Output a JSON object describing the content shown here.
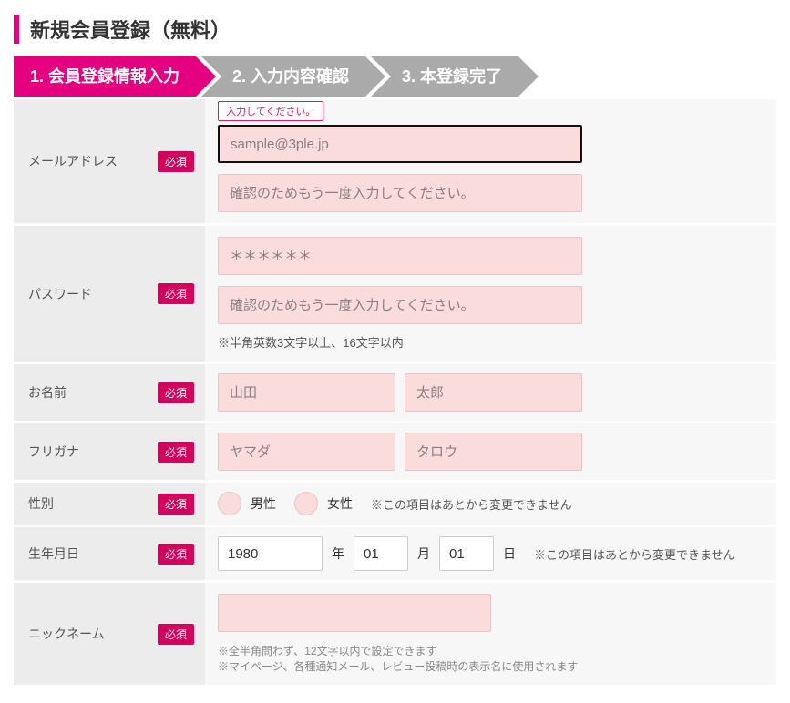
{
  "title": "新規会員登録（無料）",
  "steps": [
    {
      "label": "1. 会員登録情報入力",
      "active": true
    },
    {
      "label": "2. 入力内容確認",
      "active": false
    },
    {
      "label": "3. 本登録完了",
      "active": false
    }
  ],
  "required_badge": "必須",
  "errors": {
    "email1": "入力してください。"
  },
  "email": {
    "label": "メールアドレス",
    "placeholder1": "sample@3ple.jp",
    "placeholder2": "確認のためもう一度入力してください。"
  },
  "password": {
    "label": "パスワード",
    "placeholder1": "＊＊＊＊＊＊",
    "placeholder2": "確認のためもう一度入力してください。",
    "note": "※半角英数3文字以上、16文字以内"
  },
  "name": {
    "label": "お名前",
    "last_ph": "山田",
    "first_ph": "太郎"
  },
  "kana": {
    "label": "フリガナ",
    "last_ph": "ヤマダ",
    "first_ph": "タロウ"
  },
  "gender": {
    "label": "性別",
    "male": "男性",
    "female": "女性",
    "note": "※この項目はあとから変更できません"
  },
  "birth": {
    "label": "生年月日",
    "year": "1980",
    "month": "01",
    "day": "01",
    "year_unit": "年",
    "month_unit": "月",
    "day_unit": "日",
    "note": "※この項目はあとから変更できません"
  },
  "nickname": {
    "label": "ニックネーム",
    "hint1": "※全半角問わず、12文字以内で設定できます",
    "hint2": "※マイページ、各種通知メール、レビュー投稿時の表示名に使用されます"
  }
}
